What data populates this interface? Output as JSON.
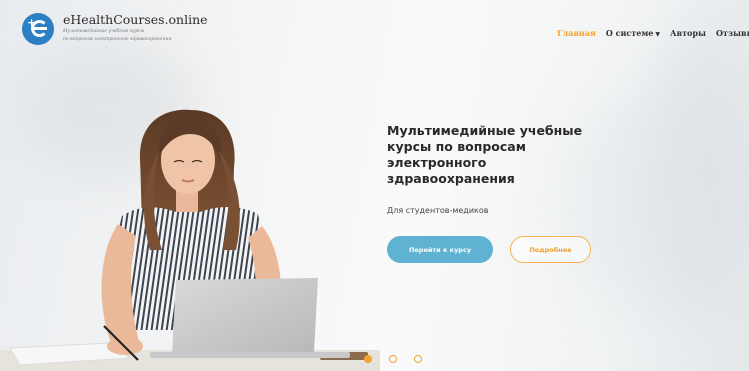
{
  "brand": {
    "title": "eHealthCourses.online",
    "subtitle_line1": "Мультимедийные учебные курсы",
    "subtitle_line2": "по вопросам электронного здравоохранения"
  },
  "nav": {
    "items": [
      {
        "label": "Главная",
        "active": true
      },
      {
        "label": "О системе",
        "dropdown": true
      },
      {
        "label": "Авторы"
      },
      {
        "label": "Отзывы"
      }
    ]
  },
  "hero": {
    "title": "Мультимедийные учебные курсы по вопросам электронного здравоохранения",
    "subtitle": "Для студентов-медиков",
    "primary_button": "Перейти к курсу",
    "secondary_button": "Подробнее"
  },
  "slider": {
    "count": 3,
    "active_index": 0
  },
  "colors": {
    "accent": "#f4a12e",
    "brand": "#2b7fc2",
    "button": "#5fb2d1"
  }
}
